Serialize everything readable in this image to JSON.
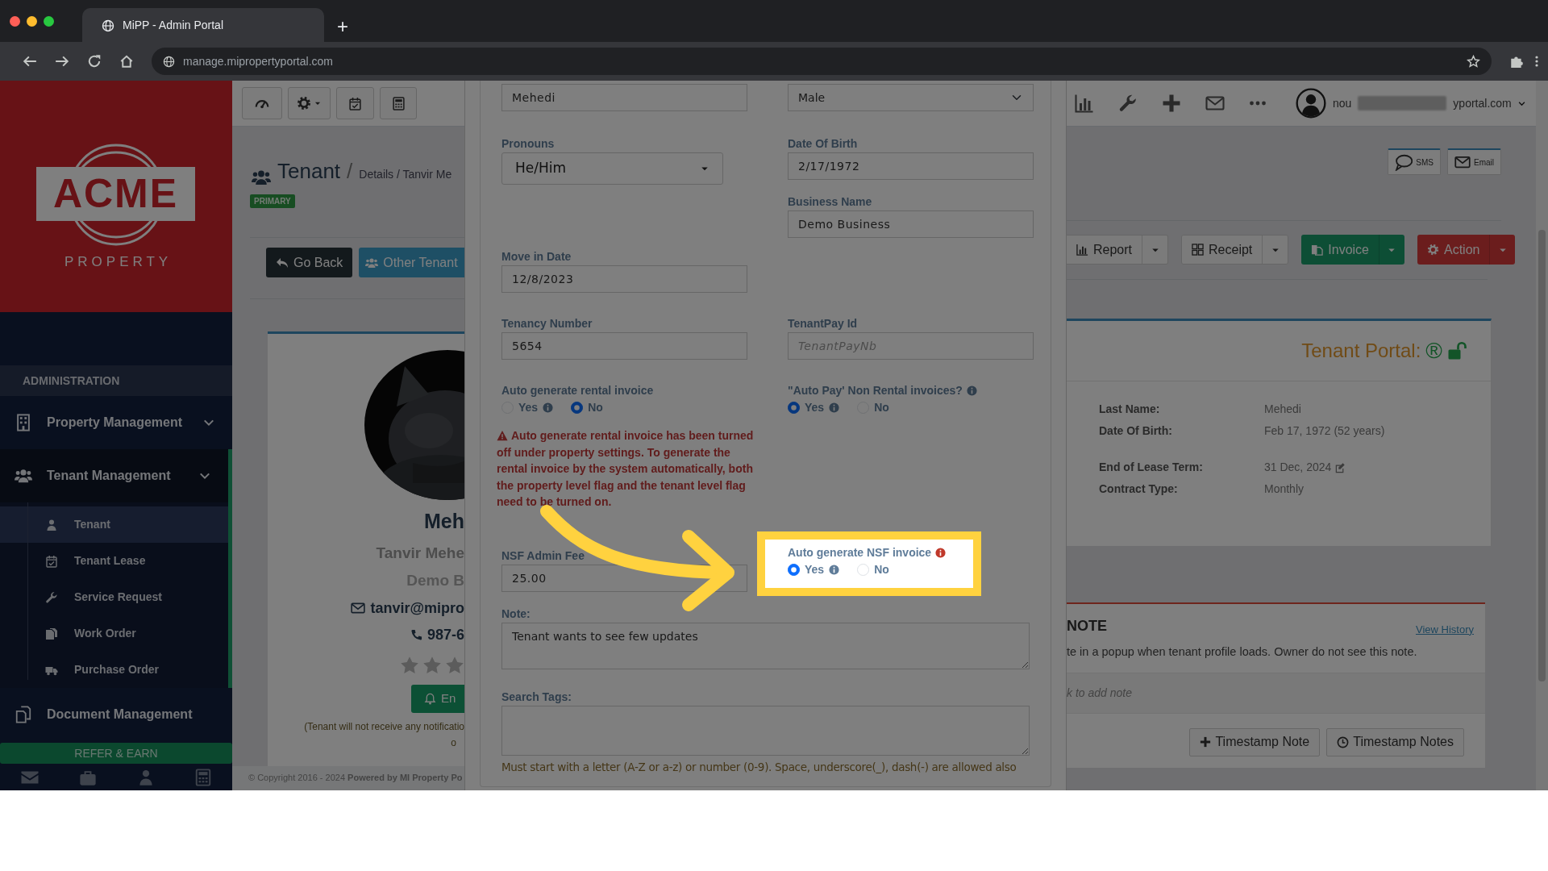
{
  "browser": {
    "tab_title": "MiPP - Admin Portal",
    "new_tab": "+",
    "url": "manage.mipropertyportal.com"
  },
  "sidebar": {
    "logo_text": "ACME",
    "logo_subtext": "PROPERTY",
    "section": "ADMINISTRATION",
    "items": [
      {
        "label": "Property Management",
        "selected": false
      },
      {
        "label": "Tenant Management",
        "selected": true,
        "children": [
          {
            "label": "Tenant",
            "selected": true
          },
          {
            "label": "Tenant Lease",
            "selected": false
          },
          {
            "label": "Service Request",
            "selected": false
          },
          {
            "label": "Work Order",
            "selected": false
          },
          {
            "label": "Purchase Order",
            "selected": false
          }
        ]
      },
      {
        "label": "Document Management",
        "selected": false
      }
    ],
    "promo": "REFER & EARN"
  },
  "header": {
    "title": "Tenant",
    "separator": "/",
    "breadcrumb": "Details / Tanvir Me",
    "badge": "PRIMARY",
    "buttons": [
      "Go Back",
      "Other Tenant"
    ]
  },
  "profile": {
    "name": "Meh",
    "full_name": "Tanvir Mehe",
    "business": "Demo B",
    "email": "tanvir@mipro",
    "phone": "987-6",
    "alert_button": "En",
    "notice": [
      "(Tenant will not receive any notificatio",
      "o"
    ]
  },
  "footer": "© Copyright 2016 - 2024 **Powered by MI Property Po**",
  "user": {
    "name_start": "nou",
    "name_end": "yportal.com"
  },
  "contact_buttons": [
    "SMS",
    "Email"
  ],
  "actions": [
    {
      "label": "Report",
      "kind": "default"
    },
    {
      "label": "Receipt",
      "kind": "default"
    },
    {
      "label": "Invoice",
      "kind": "success"
    },
    {
      "label": "Action",
      "kind": "danger"
    }
  ],
  "portal": {
    "title": "Tenant Portal:",
    "mark": "®",
    "groups": [
      [
        {
          "label": "Last Name:",
          "value": "Mehedi",
          "editable": false
        },
        {
          "label": "Date Of Birth:",
          "value": "Feb 17, 1972 (52 years)",
          "editable": false
        }
      ],
      [
        {
          "label": "End of Lease Term:",
          "value": "31 Dec, 2024",
          "editable": true
        },
        {
          "label": "Contract Type:",
          "value": "Monthly",
          "editable": false
        }
      ]
    ]
  },
  "note_card": {
    "title": "NOTE",
    "link": "View History",
    "text": "te in a popup when tenant profile loads. Owner do not see this note.",
    "hint": "k to add note",
    "buttons": [
      "Timestamp Note",
      "Timestamp Notes"
    ]
  },
  "modal": {
    "name_field": {
      "value": "Mehedi"
    },
    "gender_select": {
      "value": "Male"
    },
    "pronouns": {
      "label": "Pronouns",
      "value": "He/Him"
    },
    "date_of_birth": {
      "label": "Date Of Birth",
      "value": "2/17/1972"
    },
    "business_name": {
      "label": "Business Name",
      "value": "Demo Business"
    },
    "move_in_date": {
      "label": "Move in Date",
      "value": "12/8/2023"
    },
    "tenancy_number": {
      "label": "Tenancy Number",
      "value": "5654"
    },
    "tenantpay_id": {
      "label": "TenantPay Id",
      "placeholder": "TenantPayNb"
    },
    "rental_invoice": {
      "label": "Auto generate rental invoice",
      "info": false,
      "options": [
        {
          "label": "Yes",
          "info": true,
          "selected": false
        },
        {
          "label": "No",
          "info": false,
          "selected": true
        }
      ]
    },
    "warning": "Auto generate rental invoice has been turned off under property settings. To generate the rental invoice by the system automatically, both the property level flag and the tenant level flag need to be turned on.",
    "auto_pay": {
      "label": "\"Auto Pay' Non Rental invoices?",
      "info": true,
      "options": [
        {
          "label": "Yes",
          "info": true,
          "selected": true
        },
        {
          "label": "No",
          "info": false,
          "selected": false
        }
      ]
    },
    "nsf_fee": {
      "label": "NSF Admin Fee",
      "value": "25.00"
    },
    "nsf_invoice": {
      "label": "Auto generate NSF invoice",
      "info": true,
      "highlighted": true,
      "options": [
        {
          "label": "Yes",
          "info": true,
          "selected": true
        },
        {
          "label": "No",
          "info": false,
          "selected": false
        }
      ]
    },
    "note": {
      "label": "Note:",
      "value": "Tenant wants to see few updates"
    },
    "search_tags": {
      "label": "Search Tags:",
      "help": "Must start with a letter (A-Z or a-z) or number (0-9). Space, underscore(_), dash(-) are allowed also"
    }
  }
}
